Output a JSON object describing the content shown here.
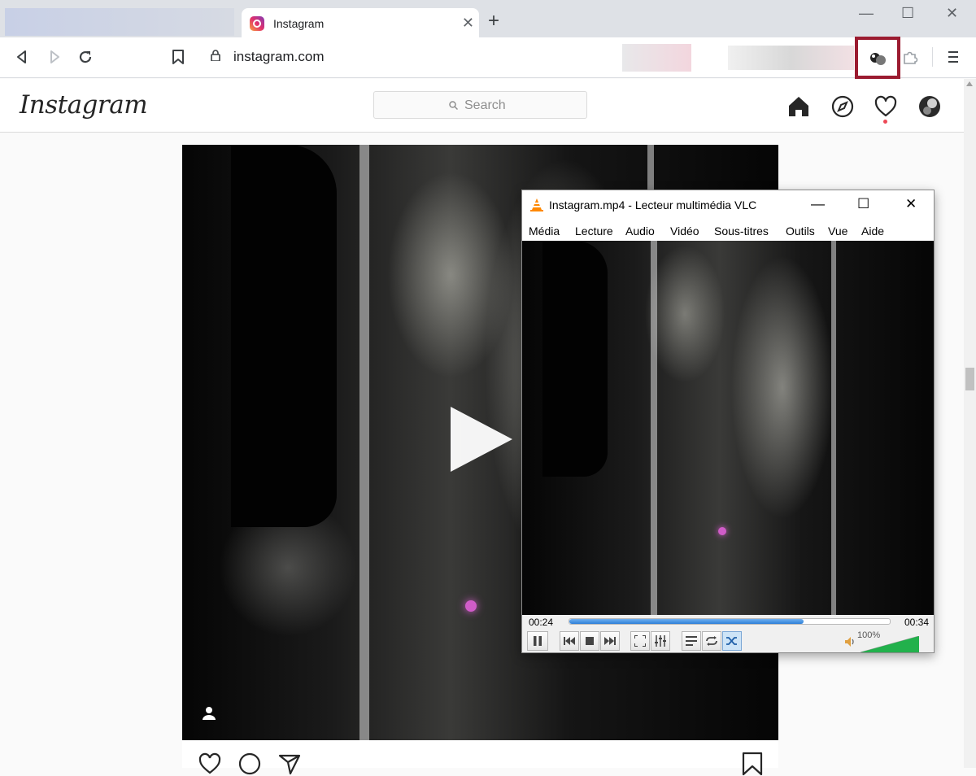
{
  "browser": {
    "tab_title": "Instagram",
    "tab_close": "✕",
    "new_tab": "+",
    "url": "instagram.com",
    "window_controls": {
      "minimize": "—",
      "maximize": "☐",
      "close": "✕"
    }
  },
  "instagram": {
    "logo": "Instagram",
    "search_placeholder": "Search"
  },
  "vlc": {
    "title": "Instagram.mp4 - Lecteur multimédia VLC",
    "menu": [
      "Média",
      "Lecture",
      "Audio",
      "Vidéo",
      "Sous-titres",
      "Outils",
      "Vue",
      "Aide"
    ],
    "time_current": "00:24",
    "time_total": "00:34",
    "progress_fraction": 0.73,
    "volume_label": "100%",
    "volume_fraction": 1.0,
    "window_controls": {
      "minimize": "—",
      "maximize": "☐",
      "close": "✕"
    }
  },
  "colors": {
    "highlight_border": "#9b1b30",
    "seek_fill": "#2e7fd7",
    "volume_green": "#22b14c",
    "notification_dot": "#ed4956"
  }
}
